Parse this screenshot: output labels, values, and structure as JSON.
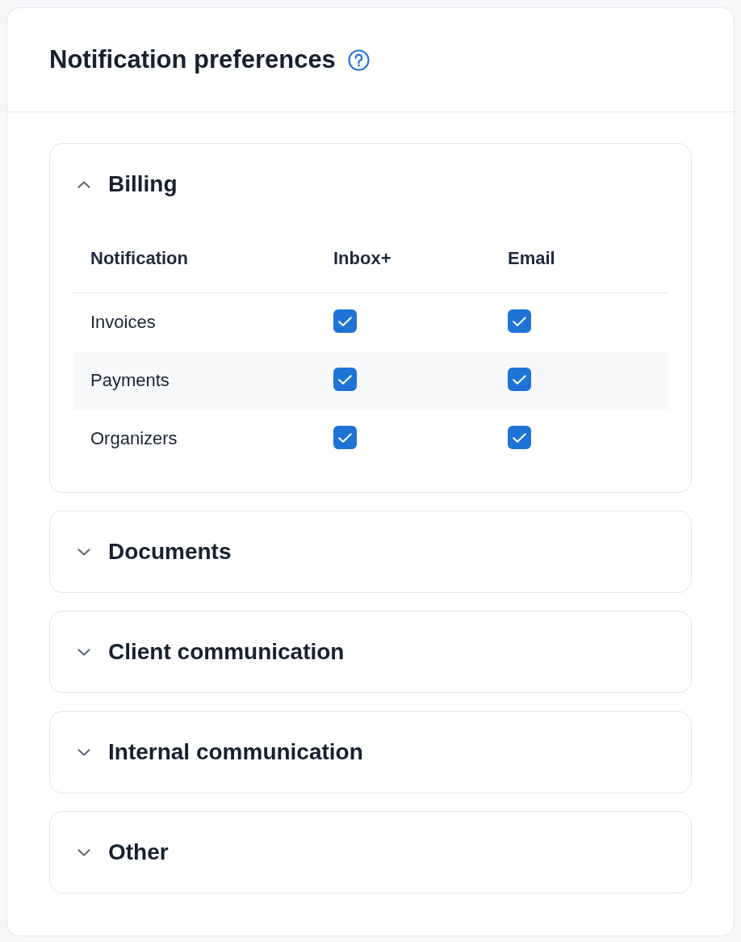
{
  "header": {
    "title": "Notification preferences"
  },
  "sections": [
    {
      "title": "Billing",
      "expanded": true,
      "table": {
        "columns": [
          "Notification",
          "Inbox+",
          "Email"
        ],
        "rows": [
          {
            "label": "Invoices",
            "highlighted": false,
            "channels": [
              {
                "checked": true
              },
              {
                "checked": true
              }
            ]
          },
          {
            "label": "Payments",
            "highlighted": true,
            "channels": [
              {
                "checked": true
              },
              {
                "checked": true
              }
            ]
          },
          {
            "label": "Organizers",
            "highlighted": false,
            "channels": [
              {
                "checked": true
              },
              {
                "checked": true
              }
            ]
          }
        ]
      }
    },
    {
      "title": "Documents",
      "expanded": false
    },
    {
      "title": "Client communication",
      "expanded": false
    },
    {
      "title": "Internal communication",
      "expanded": false
    },
    {
      "title": "Other",
      "expanded": false
    }
  ]
}
